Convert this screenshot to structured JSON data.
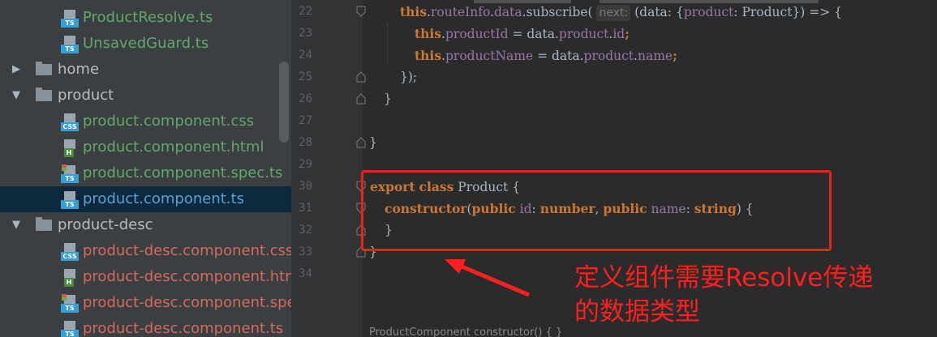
{
  "sidebar": {
    "items": [
      {
        "label": "ProductResolve.ts",
        "type": "file",
        "icon": "typescript-file-icon",
        "badge": "TS",
        "status": "added"
      },
      {
        "label": "UnsavedGuard.ts",
        "type": "file",
        "icon": "typescript-file-icon",
        "badge": "TS",
        "status": "added"
      },
      {
        "label": "home",
        "type": "folder",
        "expanded": false
      },
      {
        "label": "product",
        "type": "folder",
        "expanded": true
      },
      {
        "label": "product.component.css",
        "type": "file",
        "icon": "css-file-icon",
        "badge": "CSS",
        "status": "added"
      },
      {
        "label": "product.component.html",
        "type": "file",
        "icon": "html-file-icon",
        "badge": "H",
        "status": "added"
      },
      {
        "label": "product.component.spec.ts",
        "type": "file",
        "icon": "spec-file-icon",
        "badge": "TS",
        "status": "added"
      },
      {
        "label": "product.component.ts",
        "type": "file",
        "icon": "typescript-file-icon",
        "badge": "TS",
        "status": "modified",
        "selected": true
      },
      {
        "label": "product-desc",
        "type": "folder",
        "expanded": true
      },
      {
        "label": "product-desc.component.css",
        "type": "file",
        "icon": "css-file-icon",
        "badge": "CSS",
        "status": "unversioned"
      },
      {
        "label": "product-desc.component.htm",
        "type": "file",
        "icon": "html-file-icon",
        "badge": "H",
        "status": "unversioned"
      },
      {
        "label": "product-desc.component.spec",
        "type": "file",
        "icon": "spec-file-icon",
        "badge": "TS",
        "status": "unversioned"
      },
      {
        "label": "product-desc.component.ts",
        "type": "file",
        "icon": "typescript-file-icon",
        "badge": "TS",
        "status": "unversioned"
      }
    ],
    "arrow_collapsed": "▶",
    "arrow_expanded": "▼"
  },
  "editor": {
    "line_numbers": [
      "22",
      "23",
      "24",
      "25",
      "26",
      "27",
      "28",
      "29",
      "30",
      "31",
      "32",
      "33",
      "34"
    ],
    "lines": {
      "l22": {
        "a": "this",
        "b": ".",
        "c": "routeInfo",
        "d": ".",
        "e": "data",
        "f": ".subscribe( ",
        "hint": "next:",
        "g": " (data: {",
        "h": "product",
        "i": ": Product}) => {"
      },
      "l23": {
        "a": "this",
        "b": ".",
        "c": "productId",
        "d": " = data.",
        "e": "product",
        "f": ".",
        "g": "id",
        "h": ";"
      },
      "l24": {
        "a": "this",
        "b": ".",
        "c": "productName",
        "d": " = data.",
        "e": "product",
        "f": ".",
        "g": "name",
        "h": ";"
      },
      "l25": {
        "a": "});"
      },
      "l26": {
        "a": "}"
      },
      "l28": {
        "a": "}"
      },
      "l30": {
        "kw1": "export",
        "kw2": "class",
        "rest": " Product {"
      },
      "l31": {
        "kw": "constructor",
        "p1": "(",
        "kw2": "public",
        "id": "id",
        "c1": ": ",
        "t1": "number",
        "c2": ", ",
        "kw3": "public",
        "nm": "name",
        "c3": ": ",
        "t2": "string",
        "end": ") {"
      },
      "l32": {
        "a": "}"
      },
      "l33": {
        "a": "}"
      }
    },
    "bottom_partial": "ProductComponent   constructor() {   }"
  },
  "annotation": {
    "text_line1": "定义组件需要Resolve传递",
    "text_line2": "的数据类型"
  },
  "colors": {
    "keyword": "#cc7832",
    "property": "#9876aa",
    "annotation": "#ff1f1f"
  }
}
